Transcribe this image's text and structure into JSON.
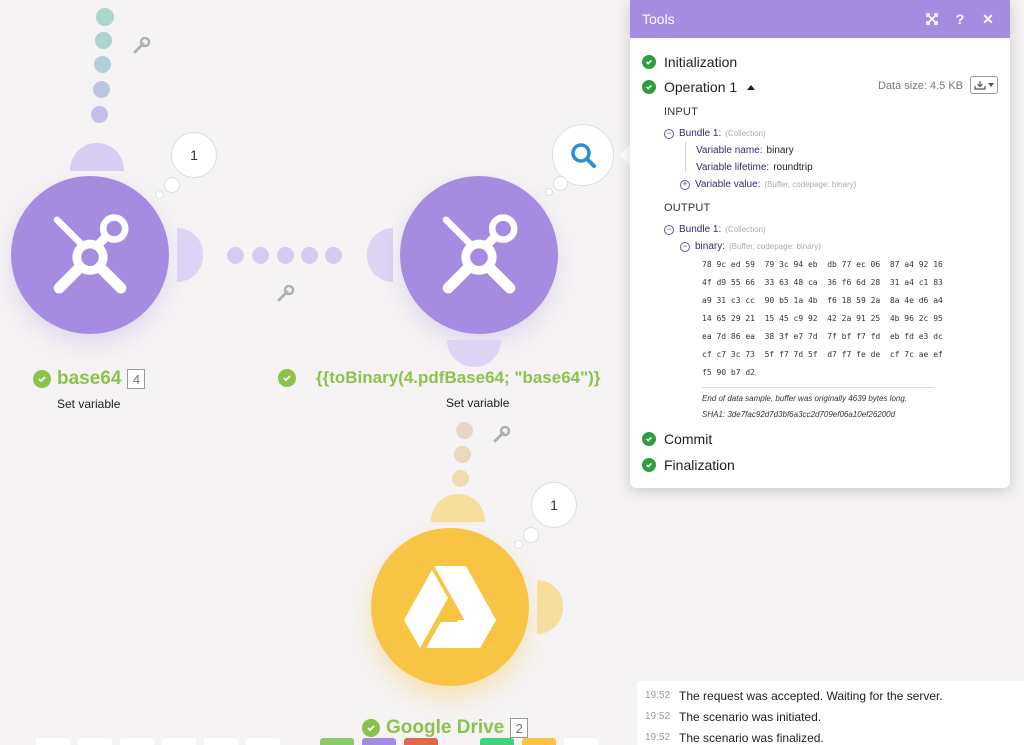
{
  "modules": {
    "base64": {
      "title": "base64",
      "count": "4",
      "subtitle": "Set variable",
      "bubble": "1"
    },
    "to_binary": {
      "title": "{{toBinary(4.pdfBase64; \"base64\")}",
      "subtitle": "Set variable"
    },
    "google_drive": {
      "title": "Google Drive",
      "count": "2",
      "bubble": "1"
    }
  },
  "tools_panel": {
    "title": "Tools",
    "steps": {
      "initialization": "Initialization",
      "operation": "Operation 1",
      "commit": "Commit",
      "finalization": "Finalization"
    },
    "data_size": "Data size: 4.5 KB",
    "input": {
      "label": "INPUT",
      "bundle": "Bundle 1:",
      "bundle_meta": "(Collection)",
      "var_name_key": "Variable name:",
      "var_name_val": "binary",
      "var_life_key": "Variable lifetime:",
      "var_life_val": "roundtrip",
      "var_value_key": "Variable value:",
      "var_value_meta": "(Buffer, codepage: binary)"
    },
    "output": {
      "label": "OUTPUT",
      "bundle": "Bundle 1:",
      "bundle_meta": "(Collection)",
      "binary_key": "binary:",
      "binary_meta": "(Buffer, codepage: binary)",
      "hex_rows": [
        "78 9c ed 59  79 3c 94 eb  db 77 ec 06  87 a4 92 16",
        "4f d9 55 66  33 63 48 ca  36 f6 6d 28  31 a4 c1 83",
        "a9 31 c3 cc  90 b5 1a 4b  f6 18 59 2a  8a 4e d6 a4",
        "14 65 29 21  15 45 c9 92  42 2a 91 25  4b 96 2c 95",
        "ea 7d 86 ea  38 3f e7 7d  7f bf f7 fd  eb fd e3 dc",
        "cf c7 3c 73  5f f7 7d 5f  d7 f7 fe de  cf 7c ae ef",
        "f5 90 b7 d2"
      ],
      "end_note": "End of data sample, buffer was originally 4639 bytes long.",
      "sha_note": "SHA1: 3de7fac92d7d3bf6a3cc2d709ef06a10ef26200d"
    }
  },
  "log": [
    {
      "time": "19:52",
      "text": "The request was accepted. Waiting for the server."
    },
    {
      "time": "19:52",
      "text": "The scenario was initiated."
    },
    {
      "time": "19:52",
      "text": "The scenario was finalized."
    }
  ],
  "colors": {
    "module_purple": "#a58ce1",
    "module_yellow": "#f7c443",
    "success_green": "#8bc34a",
    "check_green": "#2e9e3e"
  }
}
